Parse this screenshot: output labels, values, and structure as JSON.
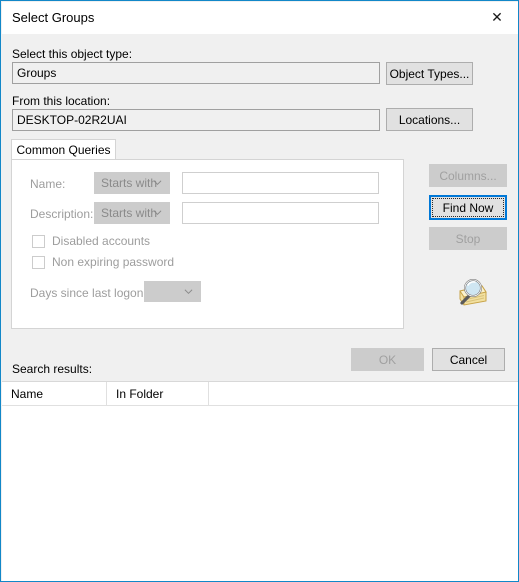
{
  "window": {
    "title": "Select Groups",
    "close_label": "✕",
    "accent_color": "#1287c8",
    "focus_color": "#0078d7"
  },
  "object_type": {
    "label": "Select this object type:",
    "value": "Groups",
    "button_label": "Object Types..."
  },
  "location": {
    "label": "From this location:",
    "value": "DESKTOP-02R2UAI",
    "button_label": "Locations..."
  },
  "tabs": [
    {
      "label": "Common Queries"
    }
  ],
  "common_queries": {
    "name": {
      "label": "Name:",
      "operator": "Starts with",
      "value": ""
    },
    "description": {
      "label": "Description:",
      "operator": "Starts with",
      "value": ""
    },
    "checkboxes": [
      {
        "label": "Disabled accounts",
        "checked": false
      },
      {
        "label": "Non expiring password",
        "checked": false
      }
    ],
    "days_since_last_logon": {
      "label": "Days since last logon:",
      "value": ""
    }
  },
  "side_buttons": {
    "columns": "Columns...",
    "find_now": "Find Now",
    "stop": "Stop"
  },
  "search_results": {
    "label": "Search results:",
    "columns": [
      "Name",
      "In Folder"
    ],
    "rows": []
  },
  "footer": {
    "ok": "OK",
    "cancel": "Cancel"
  }
}
